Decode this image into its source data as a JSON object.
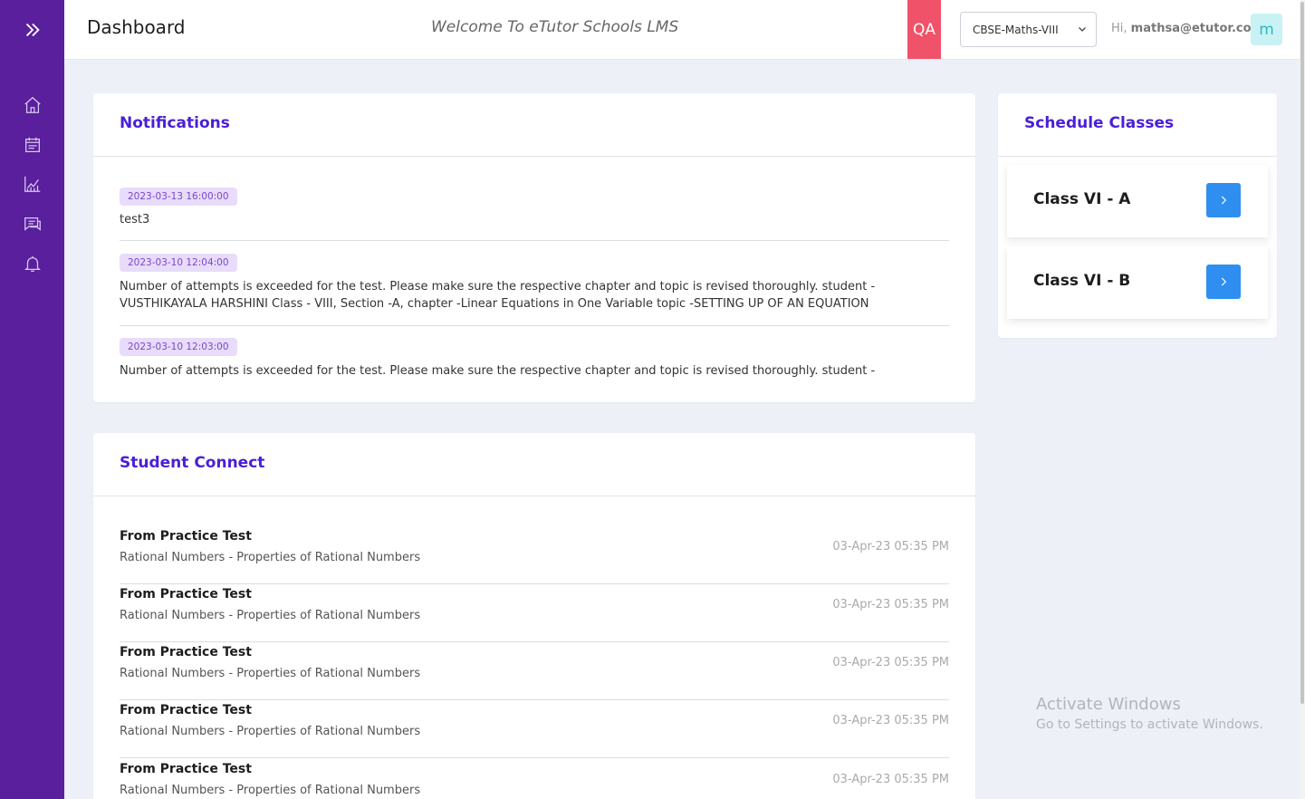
{
  "header": {
    "title": "Dashboard",
    "welcome": "Welcome To eTutor Schools LMS",
    "env_badge": "QA",
    "course_selected": "CBSE-Maths-VIII",
    "greeting_prefix": "Hi,",
    "user_email": "mathsa@etutor.co",
    "avatar_letter": "m"
  },
  "sidebar": {
    "items": [
      {
        "icon": "home-icon"
      },
      {
        "icon": "courses-icon"
      },
      {
        "icon": "reports-icon"
      },
      {
        "icon": "messages-icon"
      },
      {
        "icon": "bell-icon"
      }
    ]
  },
  "notifications": {
    "title": "Notifications",
    "items": [
      {
        "date": "2023-03-13 16:00:00",
        "text": "test3"
      },
      {
        "date": "2023-03-10 12:04:00",
        "text": "Number of attempts is exceeded for the test. Please make sure the respective chapter and topic is revised thoroughly. student - VUSTHIKAYALA HARSHINI Class - VIII, Section -A, chapter -Linear Equations in One Variable topic -SETTING UP OF AN EQUATION"
      },
      {
        "date": "2023-03-10 12:03:00",
        "text": "Number of attempts is exceeded for the test. Please make sure the respective chapter and topic is revised thoroughly. student -"
      }
    ]
  },
  "student_connect": {
    "title": "Student Connect",
    "items": [
      {
        "title": "From Practice Test",
        "subtitle": "Rational Numbers - Properties of Rational Numbers",
        "time": "03-Apr-23 05:35 PM"
      },
      {
        "title": "From Practice Test",
        "subtitle": "Rational Numbers - Properties of Rational Numbers",
        "time": "03-Apr-23 05:35 PM"
      },
      {
        "title": "From Practice Test",
        "subtitle": "Rational Numbers - Properties of Rational Numbers",
        "time": "03-Apr-23 05:35 PM"
      },
      {
        "title": "From Practice Test",
        "subtitle": "Rational Numbers - Properties of Rational Numbers",
        "time": "03-Apr-23 05:35 PM"
      },
      {
        "title": "From Practice Test",
        "subtitle": "Rational Numbers - Properties of Rational Numbers",
        "time": "03-Apr-23 05:35 PM"
      }
    ]
  },
  "schedule": {
    "title": "Schedule Classes",
    "classes": [
      {
        "name": "Class VI - A"
      },
      {
        "name": "Class VI - B"
      }
    ]
  },
  "watermark": {
    "line1": "Activate Windows",
    "line2": "Go to Settings to activate Windows."
  },
  "colors": {
    "sidebar": "#5a1f9c",
    "accent": "#4a1fd6",
    "qa_badge": "#f0526a",
    "button": "#2e8ff0"
  }
}
